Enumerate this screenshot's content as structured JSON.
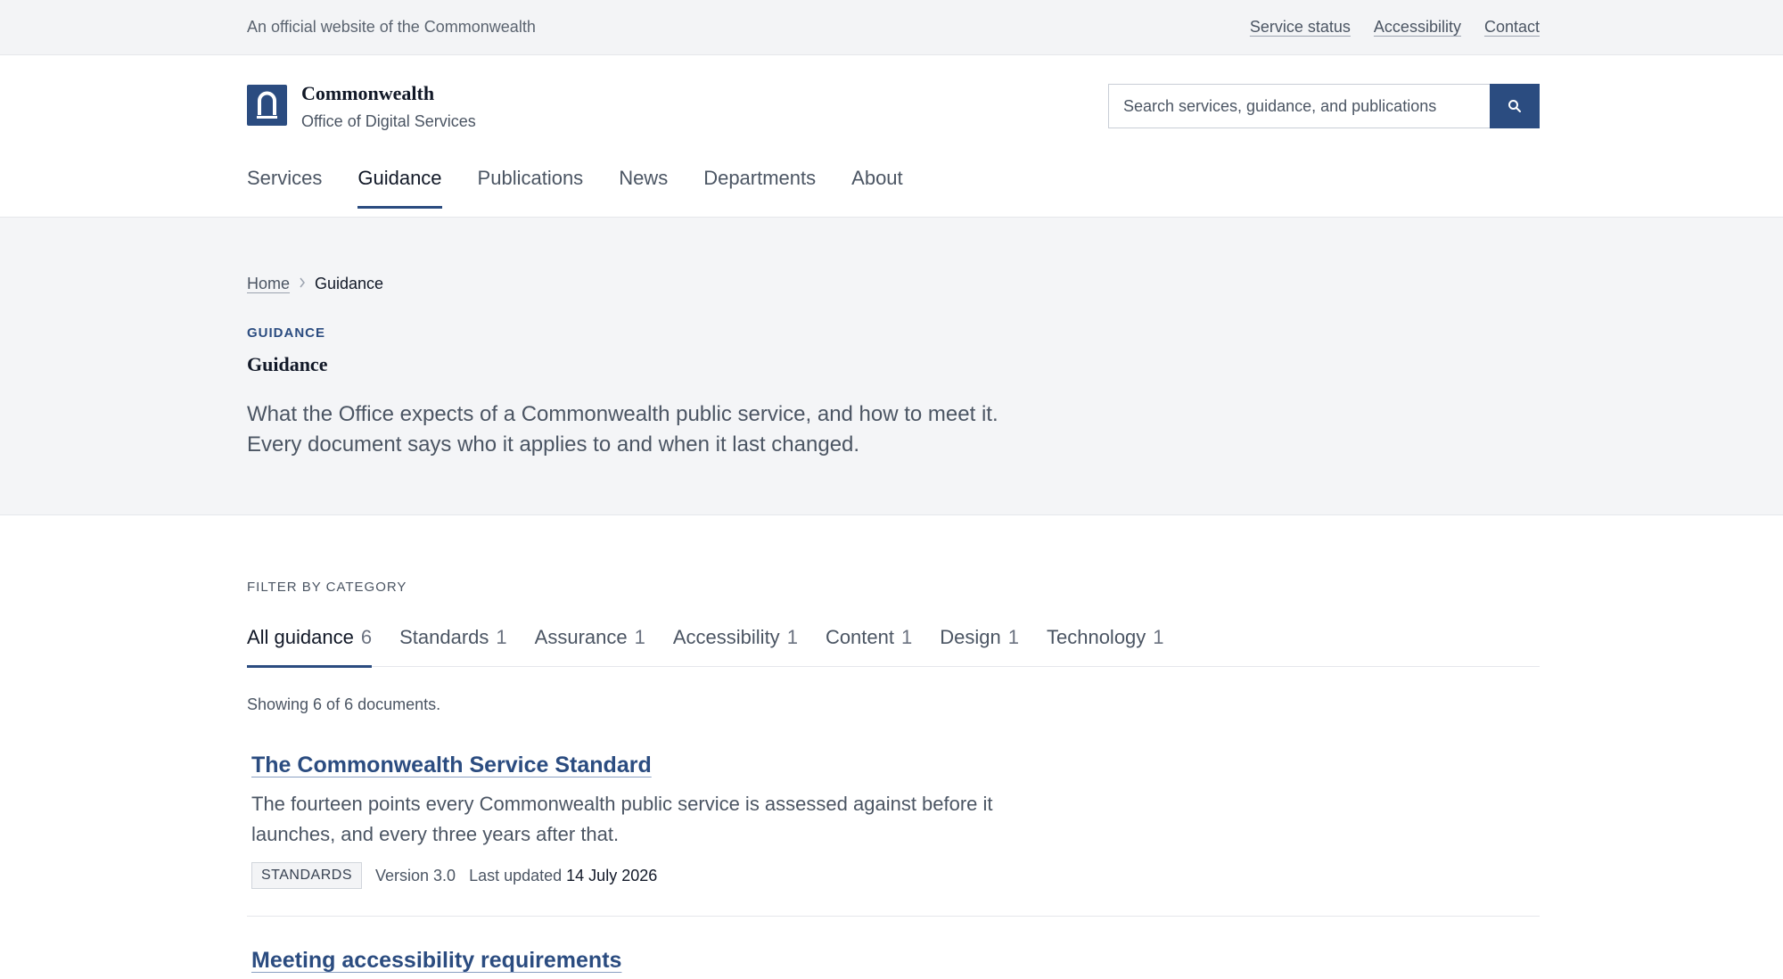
{
  "topbar": {
    "official_text": "An official website of the Commonwealth",
    "links": [
      "Service status",
      "Accessibility",
      "Contact"
    ]
  },
  "brand": {
    "name": "Commonwealth",
    "subtitle": "Office of Digital Services"
  },
  "search": {
    "placeholder": "Search services, guidance, and publications"
  },
  "nav": {
    "items": [
      "Services",
      "Guidance",
      "Publications",
      "News",
      "Departments",
      "About"
    ],
    "active": "Guidance"
  },
  "breadcrumb": {
    "home": "Home",
    "current": "Guidance"
  },
  "hero": {
    "eyebrow": "GUIDANCE",
    "title": "Guidance",
    "lede": "What the Office expects of a Commonwealth public service, and how to meet it. Every document says who it applies to and when it last changed."
  },
  "filter": {
    "label": "FILTER BY CATEGORY",
    "tabs": [
      {
        "label": "All guidance",
        "count": "6"
      },
      {
        "label": "Standards",
        "count": "1"
      },
      {
        "label": "Assurance",
        "count": "1"
      },
      {
        "label": "Accessibility",
        "count": "1"
      },
      {
        "label": "Content",
        "count": "1"
      },
      {
        "label": "Design",
        "count": "1"
      },
      {
        "label": "Technology",
        "count": "1"
      }
    ],
    "showing": "Showing 6 of 6 documents."
  },
  "documents": [
    {
      "title": "The Commonwealth Service Standard",
      "description": "The fourteen points every Commonwealth public service is assessed against before it launches, and every three years after that.",
      "tag": "STANDARDS",
      "version": "Version 3.0",
      "updated_label": "Last updated",
      "updated_date": "14 July 2026"
    },
    {
      "title": "Meeting accessibility requirements"
    }
  ],
  "colors": {
    "brand": "#2b4c80",
    "hero_bg": "#f4f5f7",
    "topbar_bg": "#f3f4f6"
  }
}
